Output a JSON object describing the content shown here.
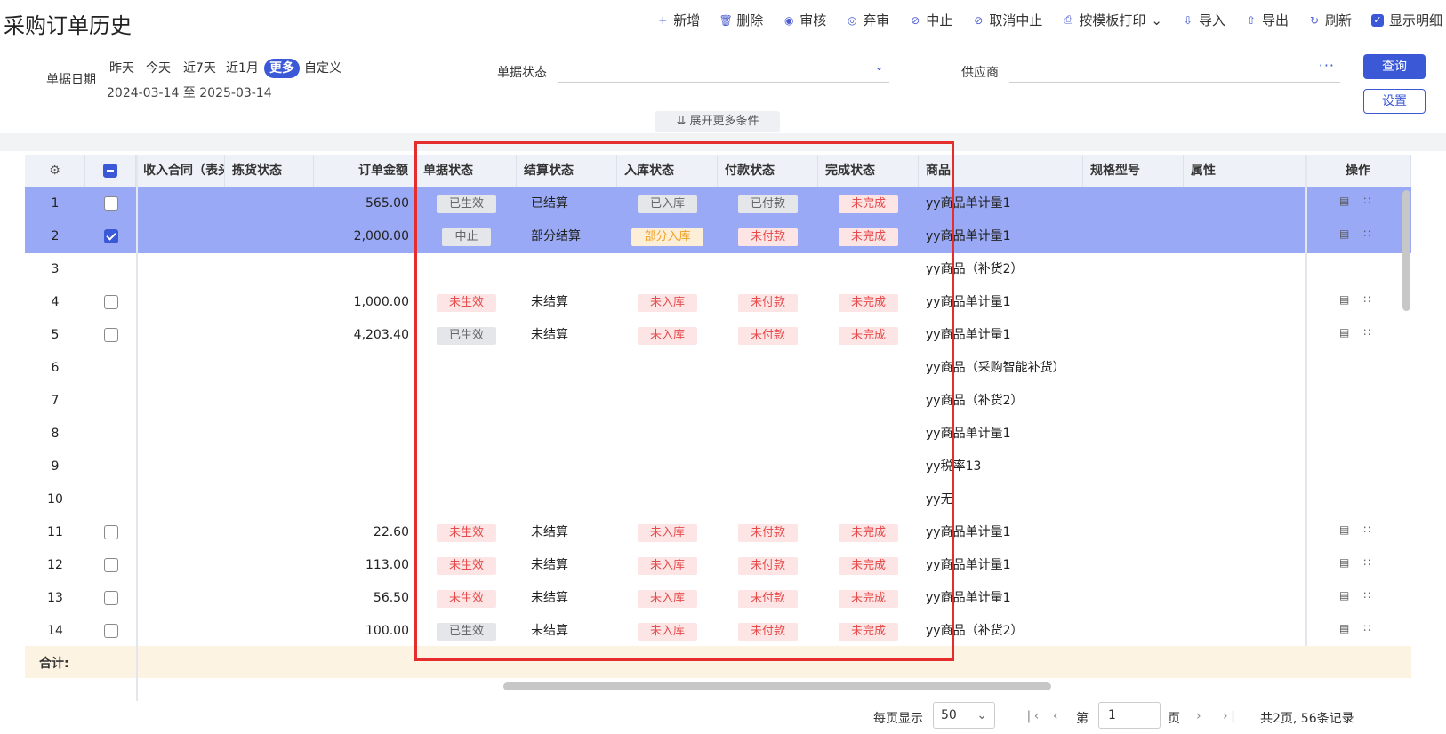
{
  "title": "采购订单历史",
  "toolbar": [
    {
      "icon": "plus-icon",
      "label": "新增"
    },
    {
      "icon": "trash-icon",
      "label": "删除"
    },
    {
      "icon": "approve-icon",
      "label": "审核"
    },
    {
      "icon": "unapprove-icon",
      "label": "弃审"
    },
    {
      "icon": "stop-icon",
      "label": "中止"
    },
    {
      "icon": "cancel-stop-icon",
      "label": "取消中止"
    },
    {
      "icon": "print-icon",
      "label": "按模板打印"
    },
    {
      "icon": "import-icon",
      "label": "导入"
    },
    {
      "icon": "export-icon",
      "label": "导出"
    },
    {
      "icon": "refresh-icon",
      "label": "刷新"
    }
  ],
  "show_detail_label": "显示明细",
  "filters": {
    "date_label": "单据日期",
    "date_chips": [
      "昨天",
      "今天",
      "近7天",
      "近1月",
      "更多",
      "自定义"
    ],
    "active_chip": "更多",
    "date_range": "2024-03-14 至 2025-03-14",
    "status_label": "单据状态",
    "status_value": "",
    "supplier_label": "供应商",
    "supplier_value": "",
    "query_label": "查询",
    "settings_label": "设置",
    "expand_label": "展开更多条件"
  },
  "columns": [
    "",
    "",
    "收入合同（表头）",
    "拣货状态",
    "订单金额",
    "单据状态",
    "结算状态",
    "入库状态",
    "付款状态",
    "完成状态",
    "商品",
    "规格型号",
    "属性",
    "操作"
  ],
  "rows": [
    {
      "no": "1",
      "checked": false,
      "sel": true,
      "amount": "565.00",
      "doc": "已生效",
      "doc_c": "gray",
      "settle": "已结算",
      "stock": "已入库",
      "stock_c": "gray",
      "pay": "已付款",
      "pay_c": "gray",
      "done": "未完成",
      "done_c": "red",
      "product": "yy商品单计量1",
      "ops": true
    },
    {
      "no": "2",
      "checked": true,
      "sel": true,
      "amount": "2,000.00",
      "doc": "中止",
      "doc_c": "gray",
      "settle": "部分结算",
      "stock": "部分入库",
      "stock_c": "orange",
      "pay": "未付款",
      "pay_c": "red",
      "done": "未完成",
      "done_c": "red",
      "product": "yy商品单计量1",
      "ops": true
    },
    {
      "no": "3",
      "checked": null,
      "sel": false,
      "amount": "",
      "doc": "",
      "doc_c": "",
      "settle": "",
      "stock": "",
      "stock_c": "",
      "pay": "",
      "pay_c": "",
      "done": "",
      "done_c": "",
      "product": "yy商品（补货2）",
      "ops": false
    },
    {
      "no": "4",
      "checked": false,
      "sel": false,
      "amount": "1,000.00",
      "doc": "未生效",
      "doc_c": "red",
      "settle": "未结算",
      "stock": "未入库",
      "stock_c": "red",
      "pay": "未付款",
      "pay_c": "red",
      "done": "未完成",
      "done_c": "red",
      "product": "yy商品单计量1",
      "ops": true
    },
    {
      "no": "5",
      "checked": false,
      "sel": false,
      "amount": "4,203.40",
      "doc": "已生效",
      "doc_c": "gray",
      "settle": "未结算",
      "stock": "未入库",
      "stock_c": "red",
      "pay": "未付款",
      "pay_c": "red",
      "done": "未完成",
      "done_c": "red",
      "product": "yy商品单计量1",
      "ops": true
    },
    {
      "no": "6",
      "checked": null,
      "sel": false,
      "amount": "",
      "doc": "",
      "doc_c": "",
      "settle": "",
      "stock": "",
      "stock_c": "",
      "pay": "",
      "pay_c": "",
      "done": "",
      "done_c": "",
      "product": "yy商品（采购智能补货）",
      "ops": false
    },
    {
      "no": "7",
      "checked": null,
      "sel": false,
      "amount": "",
      "doc": "",
      "doc_c": "",
      "settle": "",
      "stock": "",
      "stock_c": "",
      "pay": "",
      "pay_c": "",
      "done": "",
      "done_c": "",
      "product": "yy商品（补货2）",
      "ops": false
    },
    {
      "no": "8",
      "checked": null,
      "sel": false,
      "amount": "",
      "doc": "",
      "doc_c": "",
      "settle": "",
      "stock": "",
      "stock_c": "",
      "pay": "",
      "pay_c": "",
      "done": "",
      "done_c": "",
      "product": "yy商品单计量1",
      "ops": false
    },
    {
      "no": "9",
      "checked": null,
      "sel": false,
      "amount": "",
      "doc": "",
      "doc_c": "",
      "settle": "",
      "stock": "",
      "stock_c": "",
      "pay": "",
      "pay_c": "",
      "done": "",
      "done_c": "",
      "product": "yy税率13",
      "ops": false
    },
    {
      "no": "10",
      "checked": null,
      "sel": false,
      "amount": "",
      "doc": "",
      "doc_c": "",
      "settle": "",
      "stock": "",
      "stock_c": "",
      "pay": "",
      "pay_c": "",
      "done": "",
      "done_c": "",
      "product": "yy无",
      "ops": false
    },
    {
      "no": "11",
      "checked": false,
      "sel": false,
      "amount": "22.60",
      "doc": "未生效",
      "doc_c": "red",
      "settle": "未结算",
      "stock": "未入库",
      "stock_c": "red",
      "pay": "未付款",
      "pay_c": "red",
      "done": "未完成",
      "done_c": "red",
      "product": "yy商品单计量1",
      "ops": true
    },
    {
      "no": "12",
      "checked": false,
      "sel": false,
      "amount": "113.00",
      "doc": "未生效",
      "doc_c": "red",
      "settle": "未结算",
      "stock": "未入库",
      "stock_c": "red",
      "pay": "未付款",
      "pay_c": "red",
      "done": "未完成",
      "done_c": "red",
      "product": "yy商品单计量1",
      "ops": true
    },
    {
      "no": "13",
      "checked": false,
      "sel": false,
      "amount": "56.50",
      "doc": "未生效",
      "doc_c": "red",
      "settle": "未结算",
      "stock": "未入库",
      "stock_c": "red",
      "pay": "未付款",
      "pay_c": "red",
      "done": "未完成",
      "done_c": "red",
      "product": "yy商品单计量1",
      "ops": true
    },
    {
      "no": "14",
      "checked": false,
      "sel": false,
      "amount": "100.00",
      "doc": "已生效",
      "doc_c": "gray",
      "settle": "未结算",
      "stock": "未入库",
      "stock_c": "red",
      "pay": "未付款",
      "pay_c": "red",
      "done": "未完成",
      "done_c": "red",
      "product": "yy商品（补货2）",
      "ops": true
    }
  ],
  "total_label": "合计:",
  "pager": {
    "per_page_label": "每页显示",
    "per_page_value": "50",
    "page_prefix": "第",
    "page_value": "1",
    "page_suffix": "页",
    "summary": "共2页, 56条记录"
  },
  "colors": {
    "primary": "#3b58d6",
    "selected_row": "#9aa9f5",
    "highlight_box": "#e52d2d",
    "total_bar": "#fdf3e2"
  }
}
